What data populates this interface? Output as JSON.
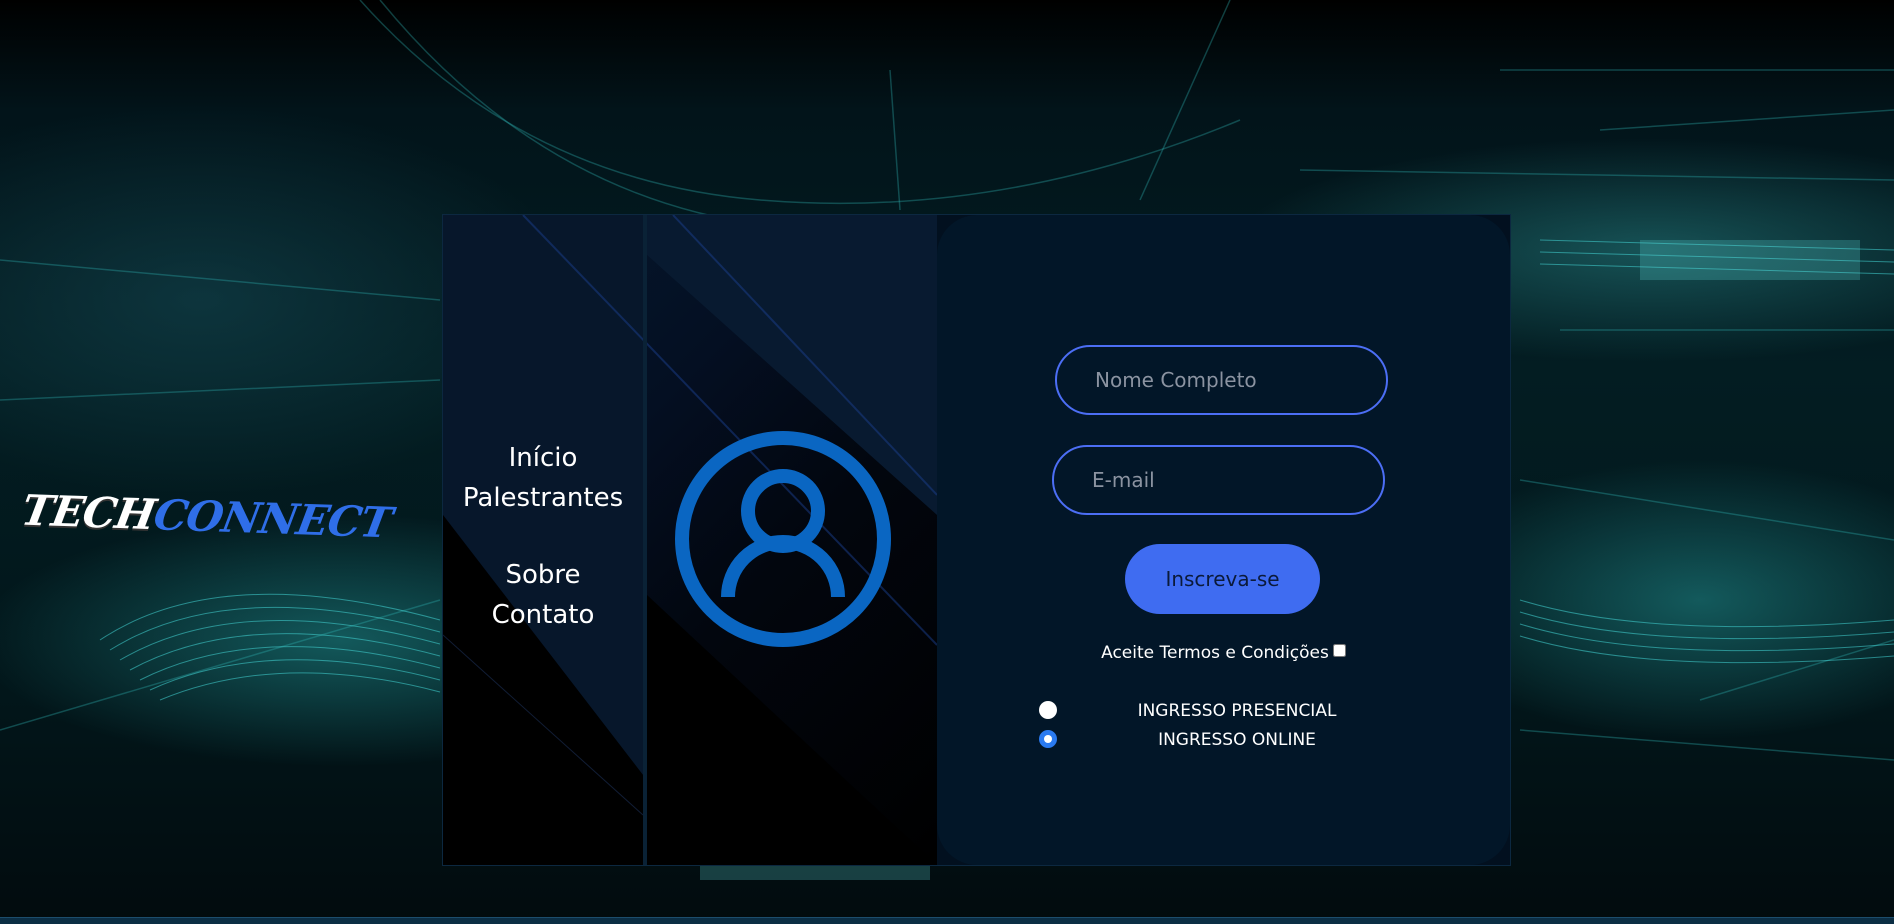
{
  "logo": {
    "part1": "TECH",
    "part2": "CONNECT"
  },
  "nav": {
    "items": [
      {
        "label": "Início"
      },
      {
        "label": "Palestrantes"
      },
      {
        "label": "Sobre"
      },
      {
        "label": "Contato"
      }
    ]
  },
  "form": {
    "name_placeholder": "Nome Completo",
    "email_placeholder": "E-mail",
    "submit_label": "Inscreva-se",
    "terms_label": "Aceite Termos e Condições",
    "terms_checked": false,
    "ticket_options": [
      {
        "label": "INGRESSO PRESENCIAL",
        "selected": false
      },
      {
        "label": "INGRESSO ONLINE",
        "selected": true
      }
    ]
  },
  "colors": {
    "accent": "#4c6ef5",
    "button": "#3f6cf1",
    "avatar": "#0a66c2",
    "logo_connect": "#2f6ee8",
    "panel": "#021628"
  },
  "icons": {
    "avatar": "user-circle-icon"
  }
}
